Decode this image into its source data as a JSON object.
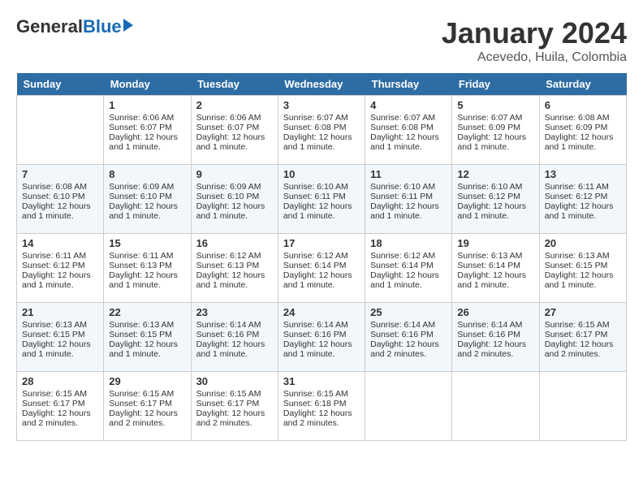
{
  "header": {
    "logo_general": "General",
    "logo_blue": "Blue",
    "month": "January 2024",
    "location": "Acevedo, Huila, Colombia"
  },
  "days_of_week": [
    "Sunday",
    "Monday",
    "Tuesday",
    "Wednesday",
    "Thursday",
    "Friday",
    "Saturday"
  ],
  "weeks": [
    [
      {
        "day": "",
        "empty": true
      },
      {
        "day": "1",
        "sunrise": "6:06 AM",
        "sunset": "6:07 PM",
        "daylight": "12 hours and 1 minute."
      },
      {
        "day": "2",
        "sunrise": "6:06 AM",
        "sunset": "6:07 PM",
        "daylight": "12 hours and 1 minute."
      },
      {
        "day": "3",
        "sunrise": "6:07 AM",
        "sunset": "6:08 PM",
        "daylight": "12 hours and 1 minute."
      },
      {
        "day": "4",
        "sunrise": "6:07 AM",
        "sunset": "6:08 PM",
        "daylight": "12 hours and 1 minute."
      },
      {
        "day": "5",
        "sunrise": "6:07 AM",
        "sunset": "6:09 PM",
        "daylight": "12 hours and 1 minute."
      },
      {
        "day": "6",
        "sunrise": "6:08 AM",
        "sunset": "6:09 PM",
        "daylight": "12 hours and 1 minute."
      }
    ],
    [
      {
        "day": "7",
        "sunrise": "6:08 AM",
        "sunset": "6:10 PM",
        "daylight": "12 hours and 1 minute."
      },
      {
        "day": "8",
        "sunrise": "6:09 AM",
        "sunset": "6:10 PM",
        "daylight": "12 hours and 1 minute."
      },
      {
        "day": "9",
        "sunrise": "6:09 AM",
        "sunset": "6:10 PM",
        "daylight": "12 hours and 1 minute."
      },
      {
        "day": "10",
        "sunrise": "6:10 AM",
        "sunset": "6:11 PM",
        "daylight": "12 hours and 1 minute."
      },
      {
        "day": "11",
        "sunrise": "6:10 AM",
        "sunset": "6:11 PM",
        "daylight": "12 hours and 1 minute."
      },
      {
        "day": "12",
        "sunrise": "6:10 AM",
        "sunset": "6:12 PM",
        "daylight": "12 hours and 1 minute."
      },
      {
        "day": "13",
        "sunrise": "6:11 AM",
        "sunset": "6:12 PM",
        "daylight": "12 hours and 1 minute."
      }
    ],
    [
      {
        "day": "14",
        "sunrise": "6:11 AM",
        "sunset": "6:12 PM",
        "daylight": "12 hours and 1 minute."
      },
      {
        "day": "15",
        "sunrise": "6:11 AM",
        "sunset": "6:13 PM",
        "daylight": "12 hours and 1 minute."
      },
      {
        "day": "16",
        "sunrise": "6:12 AM",
        "sunset": "6:13 PM",
        "daylight": "12 hours and 1 minute."
      },
      {
        "day": "17",
        "sunrise": "6:12 AM",
        "sunset": "6:14 PM",
        "daylight": "12 hours and 1 minute."
      },
      {
        "day": "18",
        "sunrise": "6:12 AM",
        "sunset": "6:14 PM",
        "daylight": "12 hours and 1 minute."
      },
      {
        "day": "19",
        "sunrise": "6:13 AM",
        "sunset": "6:14 PM",
        "daylight": "12 hours and 1 minute."
      },
      {
        "day": "20",
        "sunrise": "6:13 AM",
        "sunset": "6:15 PM",
        "daylight": "12 hours and 1 minute."
      }
    ],
    [
      {
        "day": "21",
        "sunrise": "6:13 AM",
        "sunset": "6:15 PM",
        "daylight": "12 hours and 1 minute."
      },
      {
        "day": "22",
        "sunrise": "6:13 AM",
        "sunset": "6:15 PM",
        "daylight": "12 hours and 1 minute."
      },
      {
        "day": "23",
        "sunrise": "6:14 AM",
        "sunset": "6:16 PM",
        "daylight": "12 hours and 1 minute."
      },
      {
        "day": "24",
        "sunrise": "6:14 AM",
        "sunset": "6:16 PM",
        "daylight": "12 hours and 1 minute."
      },
      {
        "day": "25",
        "sunrise": "6:14 AM",
        "sunset": "6:16 PM",
        "daylight": "12 hours and 2 minutes."
      },
      {
        "day": "26",
        "sunrise": "6:14 AM",
        "sunset": "6:16 PM",
        "daylight": "12 hours and 2 minutes."
      },
      {
        "day": "27",
        "sunrise": "6:15 AM",
        "sunset": "6:17 PM",
        "daylight": "12 hours and 2 minutes."
      }
    ],
    [
      {
        "day": "28",
        "sunrise": "6:15 AM",
        "sunset": "6:17 PM",
        "daylight": "12 hours and 2 minutes."
      },
      {
        "day": "29",
        "sunrise": "6:15 AM",
        "sunset": "6:17 PM",
        "daylight": "12 hours and 2 minutes."
      },
      {
        "day": "30",
        "sunrise": "6:15 AM",
        "sunset": "6:17 PM",
        "daylight": "12 hours and 2 minutes."
      },
      {
        "day": "31",
        "sunrise": "6:15 AM",
        "sunset": "6:18 PM",
        "daylight": "12 hours and 2 minutes."
      },
      {
        "day": "",
        "empty": true
      },
      {
        "day": "",
        "empty": true
      },
      {
        "day": "",
        "empty": true
      }
    ]
  ]
}
